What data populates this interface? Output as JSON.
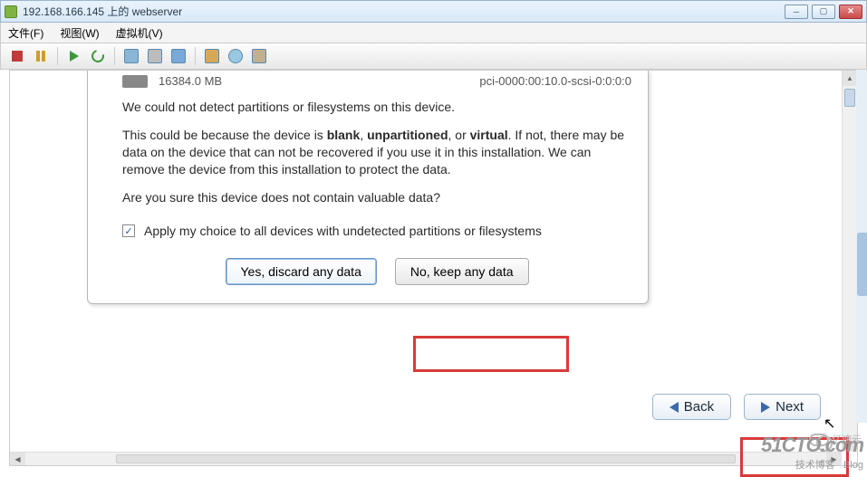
{
  "titlebar": {
    "title": "192.168.166.145 上的 webserver"
  },
  "menu": {
    "file": "文件(F)",
    "view": "视图(W)",
    "vm": "虚拟机(V)"
  },
  "device": {
    "size": "16384.0 MB",
    "path": "pci-0000:00:10.0-scsi-0:0:0:0"
  },
  "msg": {
    "nodetect": "We could not detect partitions or filesystems on this device.",
    "because_pre": "This could be because the device is ",
    "blank": "blank",
    "comma": ", ",
    "unpart": "unpartitioned",
    "or": ", or ",
    "virtual": "virtual",
    "because_post": ". If not, there may be data on the device that can not be recovered if you use it in this installation. We can remove the device from this installation to protect the data.",
    "confirm": "Are you sure this device does not contain valuable data?",
    "apply": "Apply my choice to all devices with undetected partitions or filesystems"
  },
  "btns": {
    "yes": "Yes, discard any data",
    "no": "No, keep any data",
    "back": "Back",
    "next": "Next"
  },
  "wm": {
    "site": "51CTO.com",
    "sub": "技术博客",
    "blog": "Blog",
    "brand": "亿速云"
  }
}
